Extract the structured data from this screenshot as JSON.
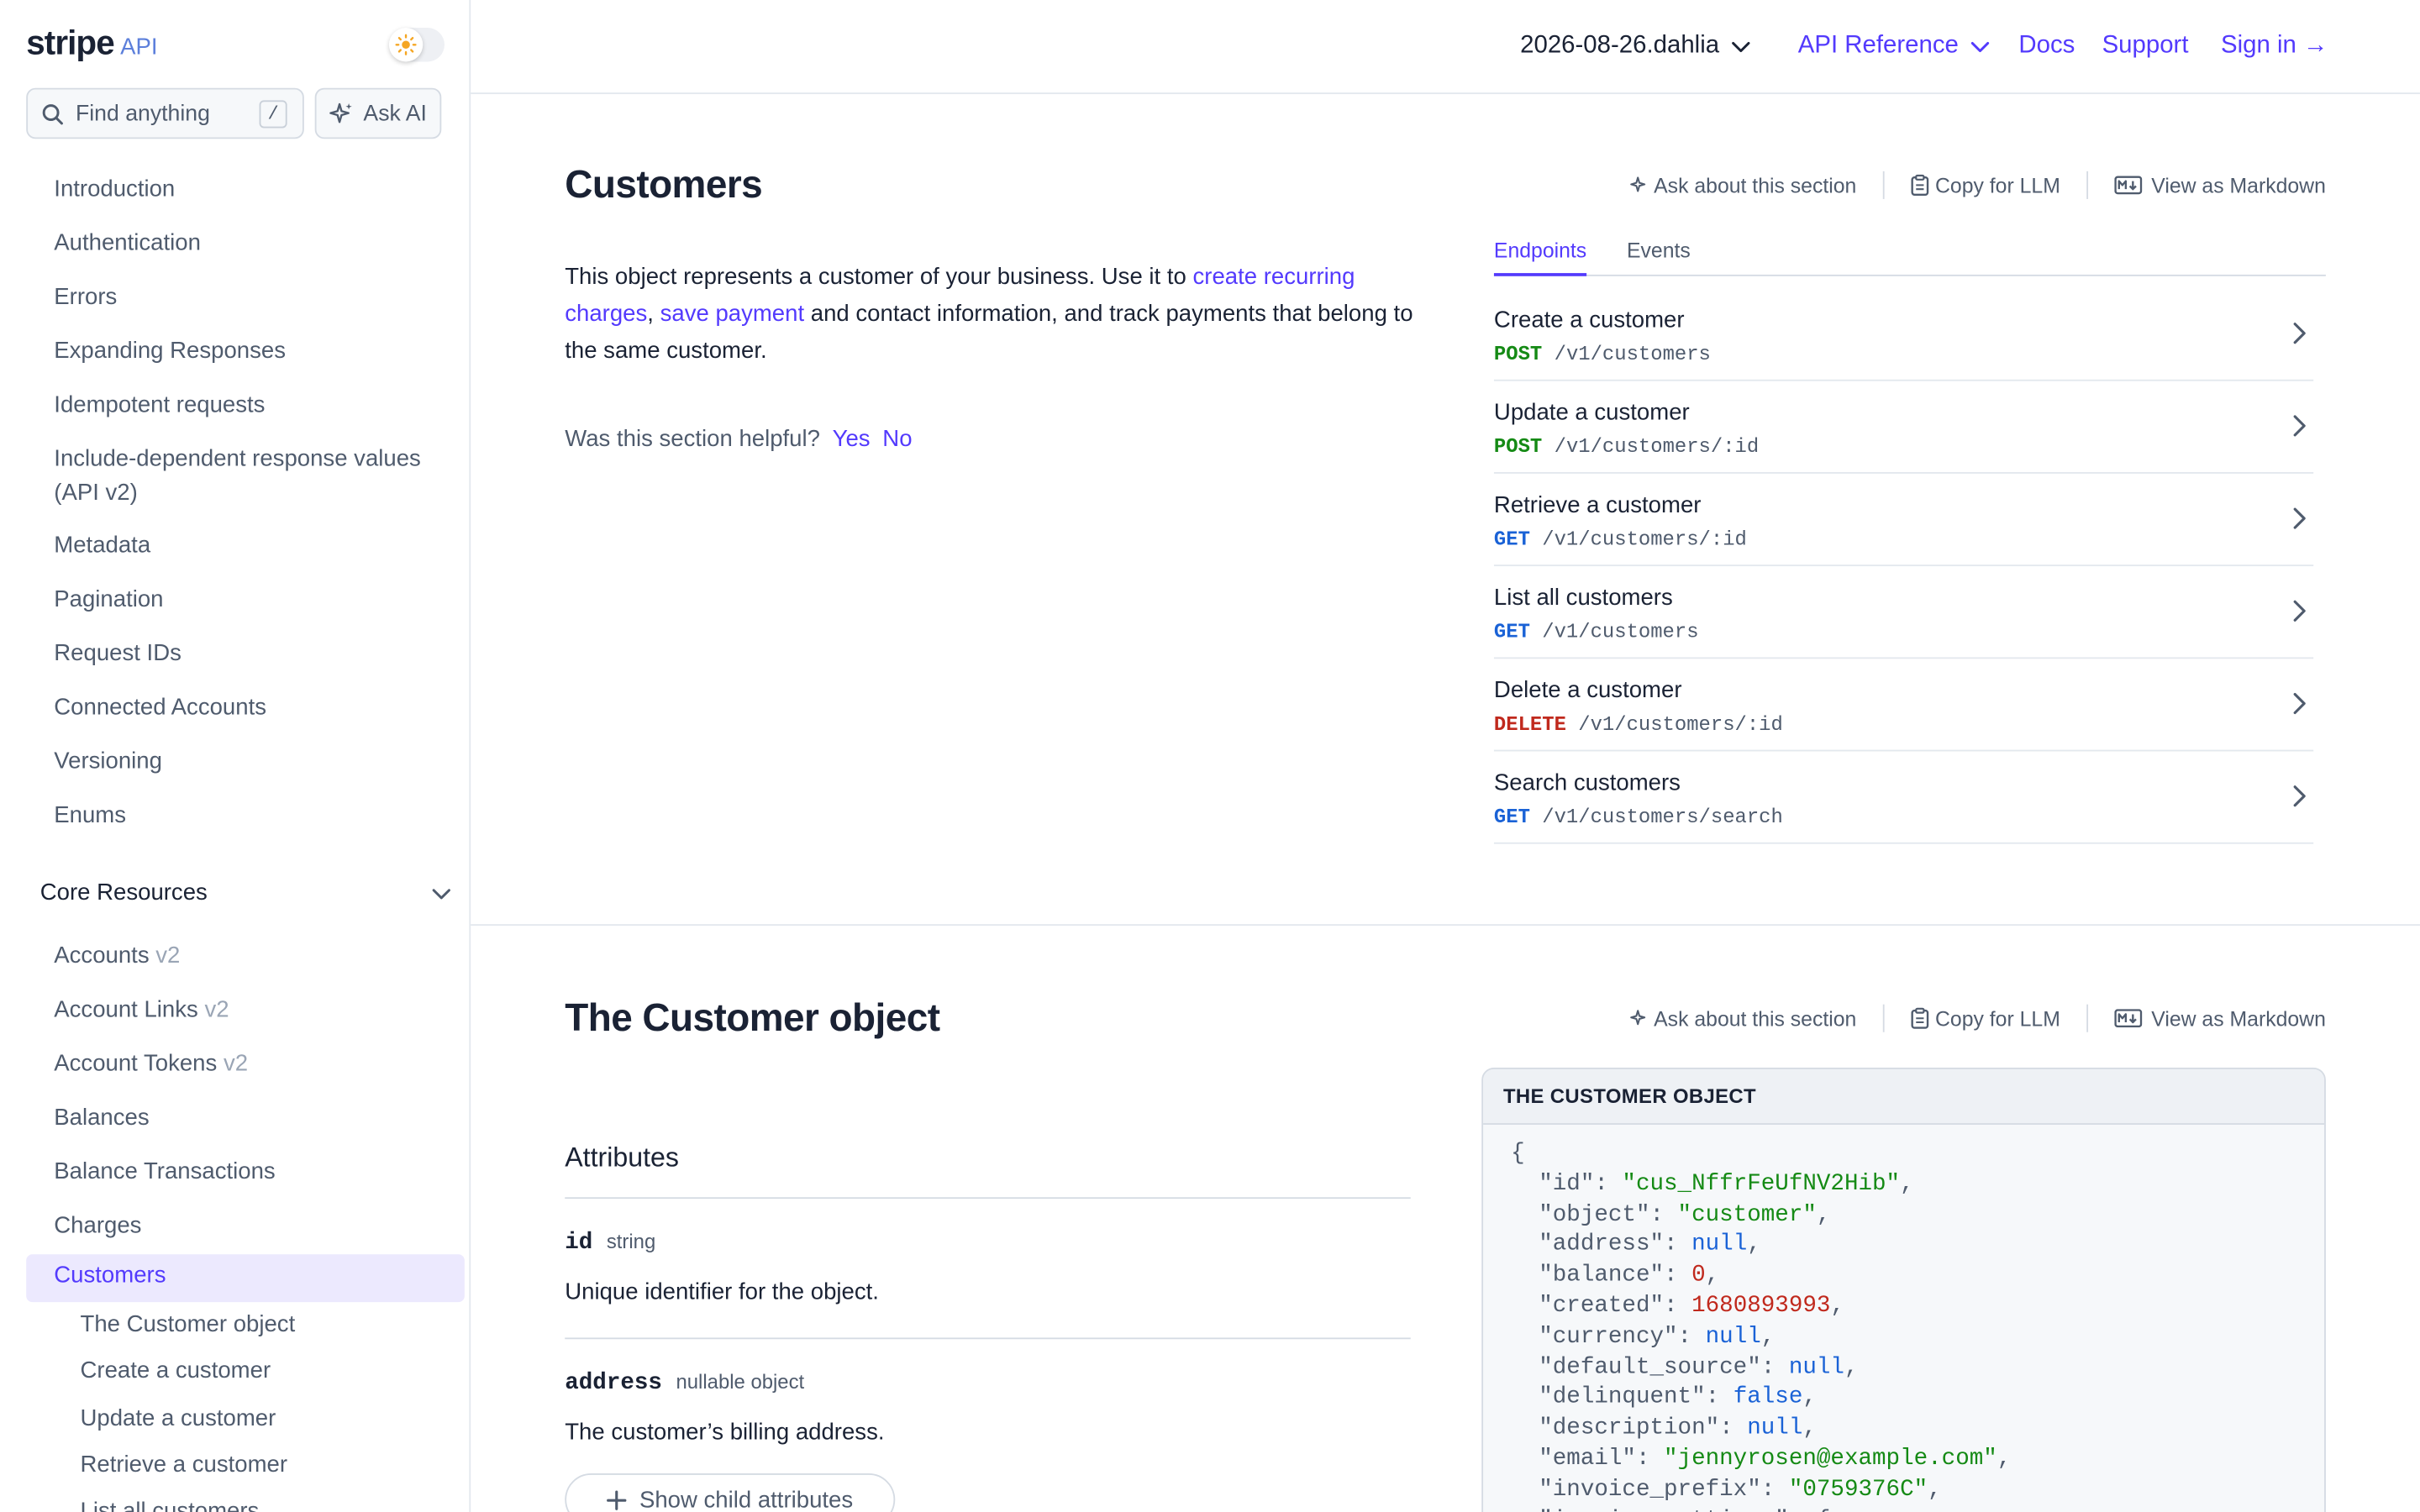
{
  "sidebar": {
    "logo": "stripe",
    "logo_suffix": "API",
    "search_label": "Find anything",
    "search_shortcut": "/",
    "ask_ai": "Ask AI",
    "items": [
      "Introduction",
      "Authentication",
      "Errors",
      "Expanding Responses",
      "Idempotent requests",
      "Include-dependent response values",
      "(API v2)",
      "Metadata",
      "Pagination",
      "Request IDs",
      "Connected Accounts",
      "Versioning",
      "Enums"
    ],
    "group_title": "Core Resources",
    "group_items": [
      {
        "label": "Accounts",
        "tag": "v2"
      },
      {
        "label": "Account Links",
        "tag": "v2"
      },
      {
        "label": "Account Tokens",
        "tag": "v2"
      },
      {
        "label": "Balances",
        "tag": ""
      },
      {
        "label": "Balance Transactions",
        "tag": ""
      },
      {
        "label": "Charges",
        "tag": ""
      }
    ],
    "active_item": "Customers",
    "sub_items": [
      "The Customer object",
      "Create a customer",
      "Update a customer",
      "Retrieve a customer",
      "List all customers"
    ]
  },
  "topbar": {
    "version": "2026-08-26.dahlia",
    "api_reference": "API Reference",
    "docs": "Docs",
    "support": "Support",
    "sign_in": "Sign in →"
  },
  "section_actions": {
    "ask": "Ask about this section",
    "copy": "Copy for LLM",
    "markdown": "View as Markdown"
  },
  "customers": {
    "title": "Customers",
    "desc_before": "This object represents a customer of your business. Use it to ",
    "link1": "create recurring charges",
    "desc_mid": ", ",
    "link2": "save payment",
    "desc_after": " and contact information, and track payments that belong to the same customer.",
    "helpful_q": "Was this section helpful?",
    "yes": "Yes",
    "no": "No",
    "tabs": [
      "Endpoints",
      "Events"
    ],
    "endpoints": [
      {
        "title": "Create a customer",
        "method": "POST",
        "path": "/v1/customers"
      },
      {
        "title": "Update a customer",
        "method": "POST",
        "path": "/v1/customers/:id"
      },
      {
        "title": "Retrieve a customer",
        "method": "GET",
        "path": "/v1/customers/:id"
      },
      {
        "title": "List all customers",
        "method": "GET",
        "path": "/v1/customers"
      },
      {
        "title": "Delete a customer",
        "method": "DELETE",
        "path": "/v1/customers/:id"
      },
      {
        "title": "Search customers",
        "method": "GET",
        "path": "/v1/customers/search"
      }
    ]
  },
  "customer_object": {
    "title": "The Customer object",
    "attributes_heading": "Attributes",
    "attributes": [
      {
        "name": "id",
        "type": "string",
        "desc": "Unique identifier for the object."
      },
      {
        "name": "address",
        "type": "nullable object",
        "desc": "The customer’s billing address."
      }
    ],
    "show_child": "Show child attributes",
    "code_title": "THE CUSTOMER OBJECT",
    "code_open": "{",
    "code_lines": [
      {
        "key": "id",
        "value": "\"cus_NffrFeUfNV2Hib\"",
        "kind": "s"
      },
      {
        "key": "object",
        "value": "\"customer\"",
        "kind": "s"
      },
      {
        "key": "address",
        "value": "null",
        "kind": "b"
      },
      {
        "key": "balance",
        "value": "0",
        "kind": "n"
      },
      {
        "key": "created",
        "value": "1680893993",
        "kind": "n"
      },
      {
        "key": "currency",
        "value": "null",
        "kind": "b"
      },
      {
        "key": "default_source",
        "value": "null",
        "kind": "b"
      },
      {
        "key": "delinquent",
        "value": "false",
        "kind": "b"
      },
      {
        "key": "description",
        "value": "null",
        "kind": "b"
      },
      {
        "key": "email",
        "value": "\"jennyrosen@example.com\"",
        "kind": "s"
      },
      {
        "key": "invoice_prefix",
        "value": "\"0759376C\"",
        "kind": "s"
      },
      {
        "key": "invoice_settings",
        "value": "{",
        "kind": "k"
      }
    ]
  }
}
